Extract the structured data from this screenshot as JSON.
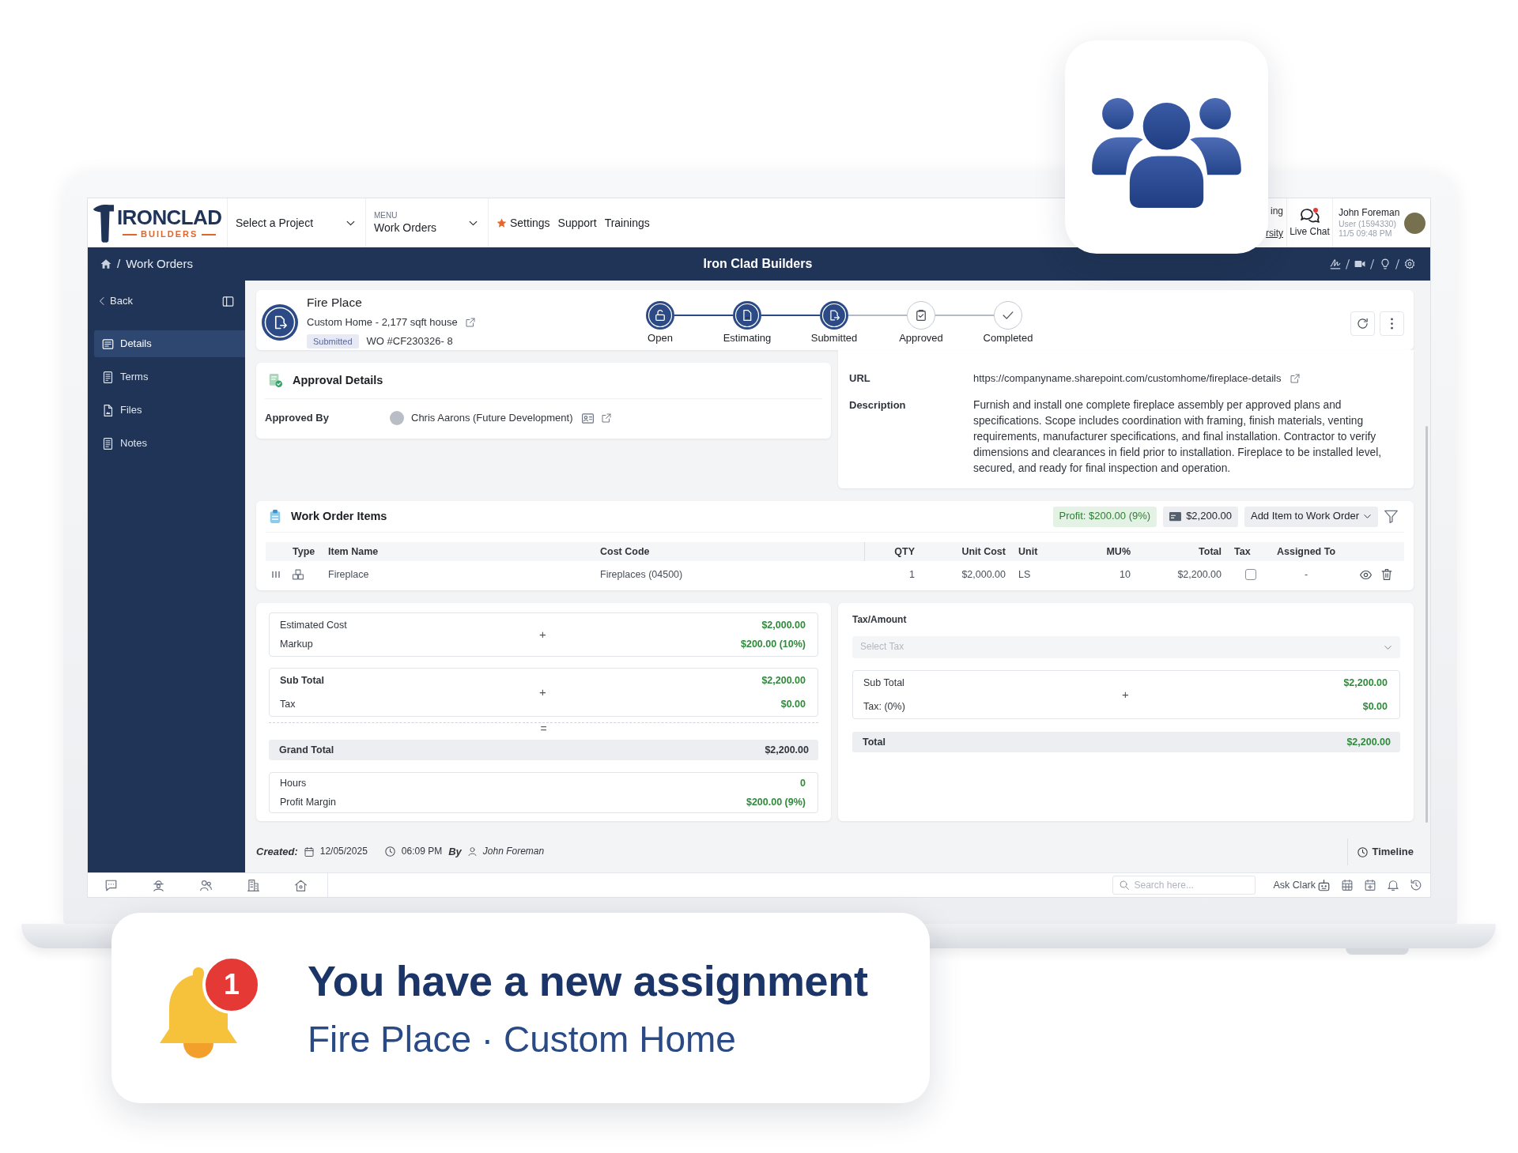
{
  "header": {
    "logo": {
      "wordmark": "IRONCLAD",
      "tagline": "BUILDERS"
    },
    "project_select": {
      "placeholder": "Select a Project"
    },
    "menu_select": {
      "label": "MENU",
      "value": "Work Orders"
    },
    "links": [
      {
        "label": "Settings",
        "starred": true
      },
      {
        "label": "Support",
        "starred": false
      },
      {
        "label": "Trainings",
        "starred": false
      }
    ],
    "covered_links": [
      {
        "text": "ing",
        "underlined": false
      },
      {
        "text": "rsity",
        "underlined": true
      }
    ],
    "live_chat": {
      "label": "Live Chat",
      "unread": true
    },
    "user": {
      "name": "John Foreman",
      "role": "User (1594330)",
      "time": "11/5 09:48 PM"
    }
  },
  "navbar": {
    "breadcrumb": {
      "separator": "/",
      "current": "Work Orders"
    },
    "title": "Iron Clad Builders"
  },
  "sidebar": {
    "back": "Back",
    "items": [
      {
        "label": "Details",
        "selected": true
      },
      {
        "label": "Terms",
        "selected": false
      },
      {
        "label": "Files",
        "selected": false
      },
      {
        "label": "Notes",
        "selected": false
      }
    ]
  },
  "work_order": {
    "title": "Fire Place",
    "project": "Custom Home - 2,177 sqft house",
    "status": "Submitted",
    "number": "WO #CF230326- 8",
    "steps": [
      {
        "label": "Open",
        "done": true
      },
      {
        "label": "Estimating",
        "done": true
      },
      {
        "label": "Submitted",
        "done": true
      },
      {
        "label": "Approved",
        "done": false
      },
      {
        "label": "Completed",
        "done": false
      }
    ]
  },
  "approval": {
    "title": "Approval Details",
    "label": "Approved By",
    "approver": "Chris Aarons (Future Development)"
  },
  "details": [
    {
      "kind": "link",
      "label": "URL",
      "value": "https://companyname.sharepoint.com/customhome/fireplace-details"
    },
    {
      "kind": "text",
      "label": "Description",
      "value": "Furnish and install one complete fireplace assembly per approved plans and specifications. Scope includes coordination with framing, finish materials, venting requirements, manufacturer specifications, and final installation. Contractor to verify dimensions and clearances in field prior to installation. Fireplace to be installed level, secured, and ready for final inspection and operation."
    }
  ],
  "items": {
    "title": "Work Order Items",
    "profit": "Profit: $200.00 (9%)",
    "total": "$2,200.00",
    "add_button": "Add Item to Work Order",
    "columns": [
      "Type",
      "Item Name",
      "Cost Code",
      "QTY",
      "Unit Cost",
      "Unit",
      "MU%",
      "Total",
      "Tax",
      "Assigned To"
    ],
    "rows": [
      {
        "item_name": "Fireplace",
        "cost_code": "Fireplaces (04500)",
        "qty": "1",
        "unit_cost": "$2,000.00",
        "unit": "LS",
        "markup": "10",
        "total": "$2,200.00",
        "taxable": false,
        "assigned_to": "-"
      }
    ]
  },
  "cost_summary": {
    "estimate": {
      "rows": [
        {
          "label": "Estimated Cost",
          "value": "$2,000.00"
        },
        {
          "label": "Markup",
          "value": "$200.00 (10%)"
        }
      ],
      "operator": "+"
    },
    "subtotal": {
      "rows": [
        {
          "label": "Sub Total",
          "value": "$2,200.00"
        },
        {
          "label": "Tax",
          "value": "$0.00"
        }
      ],
      "operator": "+"
    },
    "equals": "=",
    "grand_total": {
      "label": "Grand Total",
      "value": "$2,200.00"
    },
    "margin": {
      "rows": [
        {
          "label": "Hours",
          "value": "0"
        },
        {
          "label": "Profit Margin",
          "value": "$200.00 (9%)"
        }
      ]
    }
  },
  "tax_summary": {
    "label": "Tax/Amount",
    "select": {
      "placeholder": "Select Tax"
    },
    "subtotal": {
      "rows": [
        {
          "label": "Sub Total",
          "value": "$2,200.00"
        },
        {
          "label": "Tax: (0%)",
          "value": "$0.00"
        }
      ],
      "operator": "+"
    },
    "total": {
      "label": "Total",
      "value": "$2,200.00"
    }
  },
  "footer": {
    "created_label": "Created:",
    "date": "12/05/2025",
    "time": "06:09 PM",
    "by_label": "By",
    "author": "John Foreman",
    "timeline": "Timeline"
  },
  "toolbar": {
    "search": {
      "placeholder": "Search here..."
    },
    "assistant": "Ask Clark"
  },
  "notification": {
    "count": "1",
    "title": "You have a new assignment",
    "subtitle": "Fire Place · Custom Home"
  }
}
